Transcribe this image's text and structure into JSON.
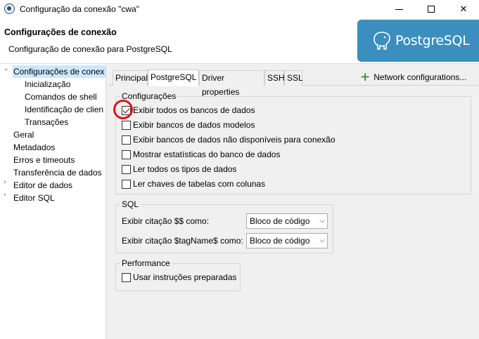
{
  "window": {
    "title": "Configuração da conexão \"cwa\""
  },
  "header": {
    "title": "Configurações de conexão",
    "subtitle": "Configuração de conexão para PostgreSQL",
    "logo_text": "PostgreSQL",
    "banner_color": "#3a8fbe"
  },
  "sidebar": {
    "items": [
      {
        "label": "Configurações de conex",
        "selected": true,
        "expanded": true
      },
      {
        "label": "Inicialização"
      },
      {
        "label": "Comandos de shell"
      },
      {
        "label": "Identificação de clien"
      },
      {
        "label": "Transações"
      },
      {
        "label": "Geral"
      },
      {
        "label": "Metadados"
      },
      {
        "label": "Erros e timeouts"
      },
      {
        "label": "Transferência de dados"
      },
      {
        "label": "Editor de dados",
        "collapsed": true
      },
      {
        "label": "Editor SQL",
        "collapsed": true
      }
    ]
  },
  "tabs": [
    {
      "label": "Principal"
    },
    {
      "label": "PostgreSQL",
      "active": true
    },
    {
      "label": "Driver properties"
    },
    {
      "label": "SSH"
    },
    {
      "label": "SSL"
    }
  ],
  "network_config": {
    "label": "Network configurations...",
    "icon": "plus-icon"
  },
  "configuracoes": {
    "legend": "Configurações",
    "options": [
      {
        "label": "Exibir todos os bancos de dados",
        "checked": true
      },
      {
        "label": "Exibir bancos de dados modelos",
        "checked": false
      },
      {
        "label": "Exibir bancos de dados não disponíveis para conexão",
        "checked": false
      },
      {
        "label": "Mostrar estatísticas do banco de dados",
        "checked": false
      },
      {
        "label": "Ler todos os tipos de dados",
        "checked": false
      },
      {
        "label": "Ler chaves de tabelas com colunas",
        "checked": false
      }
    ]
  },
  "sql": {
    "legend": "SQL",
    "fields": [
      {
        "label": "Exibir citação $$ como:",
        "value": "Bloco de código"
      },
      {
        "label": "Exibir citação $tagName$ como:",
        "value": "Bloco de código"
      }
    ]
  },
  "performance": {
    "legend": "Performance",
    "options": [
      {
        "label": "Usar instruções preparadas",
        "checked": false
      }
    ]
  },
  "annotation": {
    "color": "#e3111a"
  }
}
